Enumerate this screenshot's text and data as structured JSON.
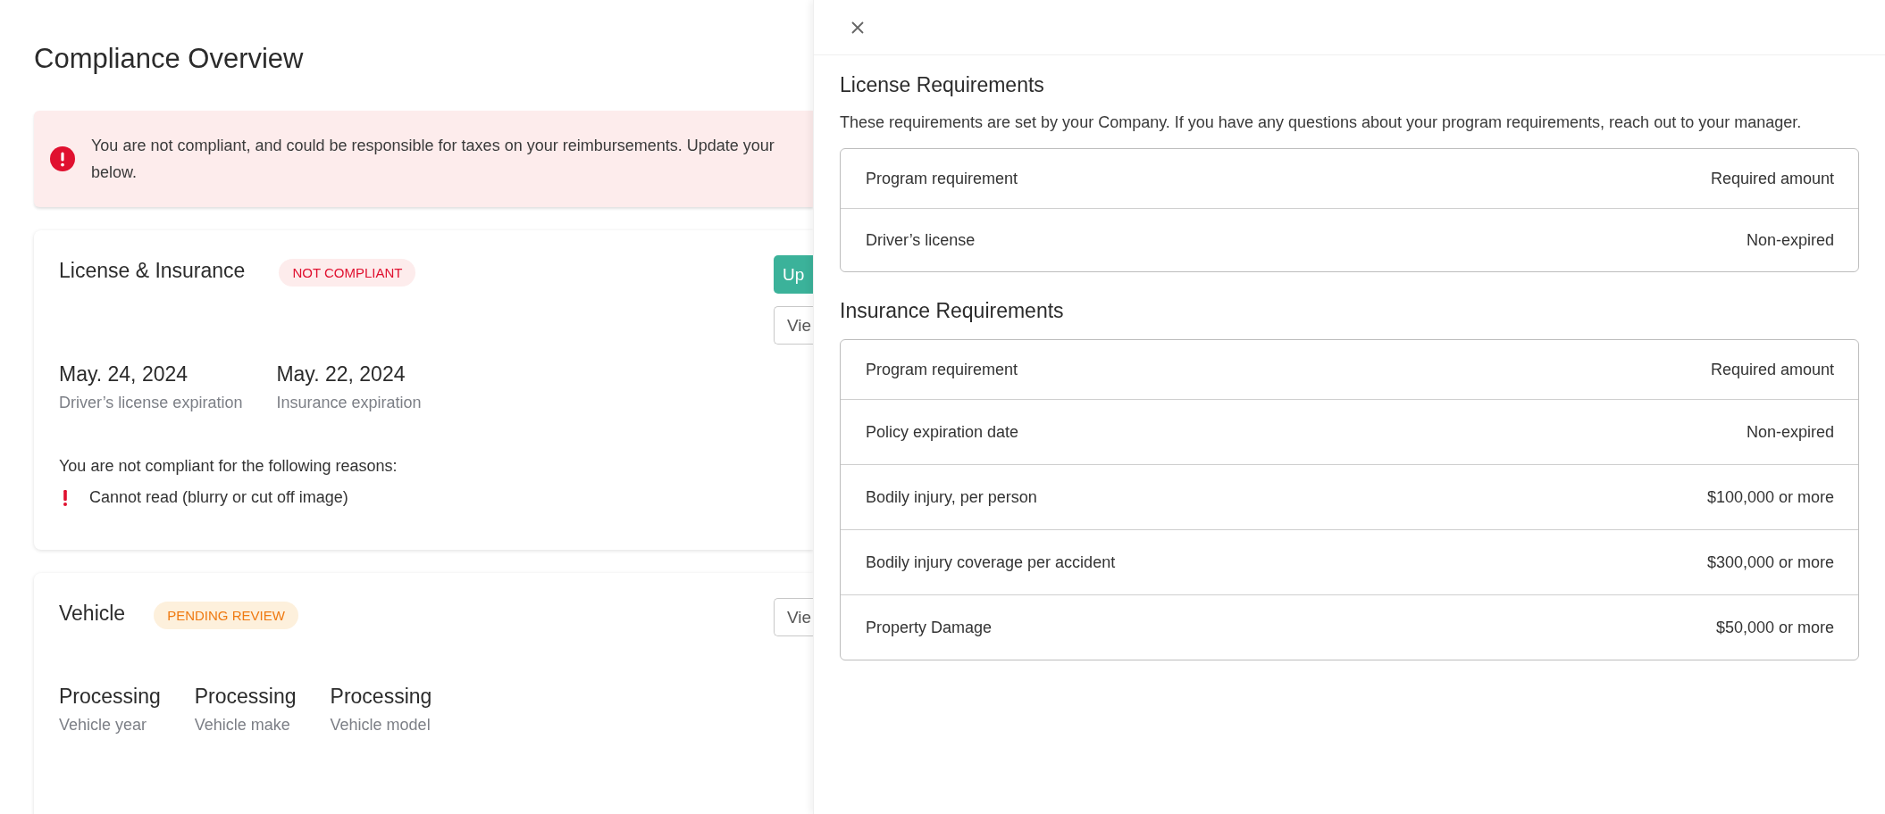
{
  "page": {
    "title": "Compliance Overview"
  },
  "alert": {
    "kind": "error",
    "text": "You are not compliant, and could be responsible for taxes on your reimbursements. Update your\nbelow."
  },
  "cards": [
    {
      "title": "License & Insurance",
      "status": {
        "label": "NOT COMPLIANT",
        "kind": "danger"
      },
      "actions": [
        {
          "label": "Up",
          "kind": "primary"
        },
        {
          "label": "Vie",
          "kind": "secondary"
        }
      ],
      "fields": [
        {
          "value": "May. 24, 2024",
          "label": "Driver’s license expiration"
        },
        {
          "value": "May. 22, 2024",
          "label": "Insurance expiration"
        }
      ],
      "reasons": {
        "heading": "You are not compliant for the following reasons:",
        "items": [
          "Cannot read (blurry or cut off image)"
        ]
      }
    },
    {
      "title": "Vehicle",
      "status": {
        "label": "PENDING REVIEW",
        "kind": "warning"
      },
      "actions": [
        {
          "label": "Vie",
          "kind": "secondary"
        }
      ],
      "fields": [
        {
          "value": "Processing",
          "label": "Vehicle year"
        },
        {
          "value": "Processing",
          "label": "Vehicle make"
        },
        {
          "value": "Processing",
          "label": "Vehicle model"
        }
      ]
    }
  ],
  "drawer": {
    "sections": [
      {
        "title": "License Requirements",
        "description": "These requirements are set by your Company. If you have any questions about your program requirements, reach out to your manager.",
        "table": {
          "columns": [
            "Program requirement",
            "Required amount"
          ],
          "rows": [
            [
              "Driver’s license",
              "Non-expired"
            ]
          ]
        }
      },
      {
        "title": "Insurance Requirements",
        "table": {
          "columns": [
            "Program requirement",
            "Required amount"
          ],
          "rows": [
            [
              "Policy expiration date",
              "Non-expired"
            ],
            [
              "Bodily injury, per person",
              "$100,000 or more"
            ],
            [
              "Bodily injury coverage per accident",
              "$300,000 or more"
            ],
            [
              "Property Damage",
              "$50,000 or more"
            ]
          ]
        }
      }
    ]
  }
}
